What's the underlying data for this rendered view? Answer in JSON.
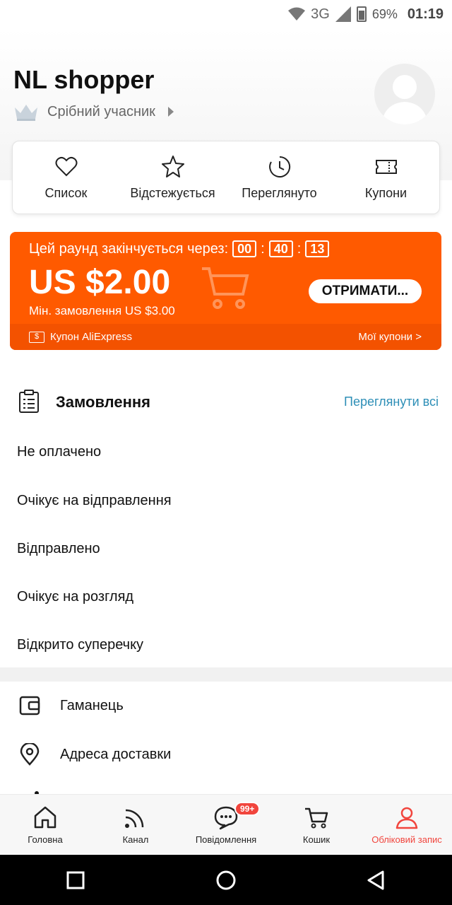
{
  "status_bar": {
    "network": "3G",
    "battery": "69%",
    "time": "01:19"
  },
  "profile": {
    "name": "NL shopper",
    "tier": "Срібний учасник"
  },
  "quick_actions": [
    {
      "label": "Список",
      "icon": "heart-icon"
    },
    {
      "label": "Відстежується",
      "icon": "star-icon"
    },
    {
      "label": "Переглянуто",
      "icon": "history-clock-icon"
    },
    {
      "label": "Купони",
      "icon": "coupon-ticket-icon"
    }
  ],
  "coupon": {
    "round_text": "Цей раунд закінчується через:",
    "timer_h": "00",
    "timer_m": "40",
    "timer_s": "13",
    "amount": "US $2.00",
    "min_order": "Мін. замовлення US $3.00",
    "button": "ОТРИМАТИ...",
    "footer_left": "Купон AliExpress",
    "footer_right": "Мої купони >",
    "colors": {
      "bg": "#ff5a00",
      "footer": "#f35200"
    }
  },
  "orders": {
    "title": "Замовлення",
    "view_all": "Переглянути всі",
    "items": [
      "Не оплачено",
      "Очікує на відправлення",
      "Відправлено",
      "Очікує на розгляд",
      "Відкрито суперечку"
    ]
  },
  "menu": [
    {
      "label": "Гаманець",
      "icon": "wallet-icon"
    },
    {
      "label": "Адреса доставки",
      "icon": "location-pin-icon"
    }
  ],
  "tabs": [
    {
      "label": "Головна",
      "icon": "home-icon"
    },
    {
      "label": "Канал",
      "icon": "feed-icon"
    },
    {
      "label": "Повідомлення",
      "icon": "chat-icon",
      "badge": "99+"
    },
    {
      "label": "Кошик",
      "icon": "cart-icon"
    },
    {
      "label": "Обліковий запис",
      "icon": "account-icon",
      "active": true
    }
  ],
  "accent_color": "#f1453d"
}
